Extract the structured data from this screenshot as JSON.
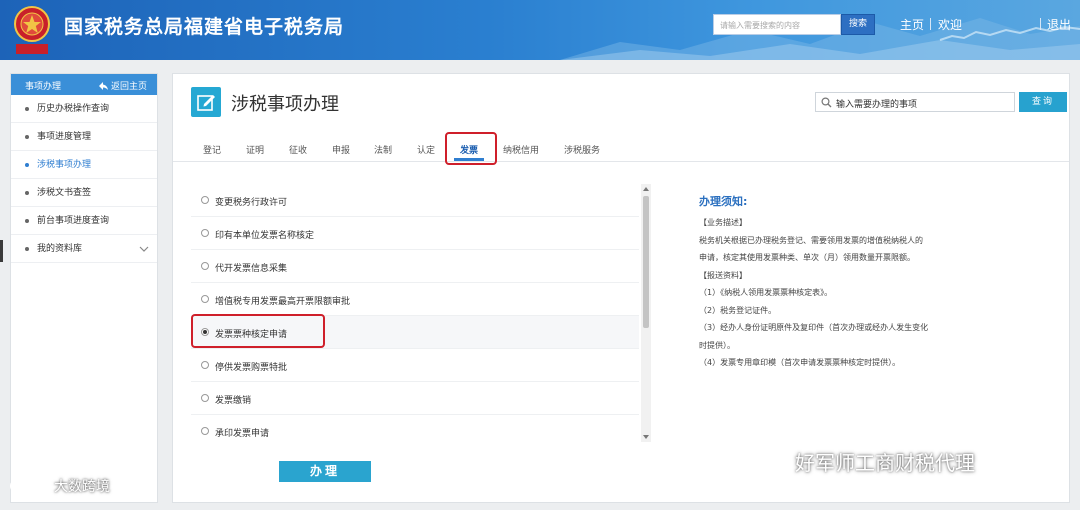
{
  "header": {
    "site_title": "国家税务总局福建省电子税务局",
    "emblem_text": "中国税务",
    "search_placeholder": "请输入需要搜索的内容",
    "search_button": "搜索",
    "home_link": "主页",
    "welcome_text": "欢迎",
    "logout_link": "退出",
    "colors": {
      "bar_start": "#1d63b8",
      "bar_end": "#5aa7e0"
    }
  },
  "sidebar": {
    "title": "事项办理",
    "back_label": "返回主页",
    "items": [
      {
        "label": "历史办税操作查询",
        "active": false
      },
      {
        "label": "事项进度管理",
        "active": false
      },
      {
        "label": "涉税事项办理",
        "active": true
      },
      {
        "label": "涉税文书查签",
        "active": false
      },
      {
        "label": "前台事项进度查询",
        "active": false
      },
      {
        "label": "我的资料库",
        "active": false,
        "expandable": true
      }
    ]
  },
  "main": {
    "page_title": "涉税事项办理",
    "search_placeholder": "输入需要办理的事项",
    "search_button": "查询",
    "tabs": [
      {
        "label": "登记"
      },
      {
        "label": "证明"
      },
      {
        "label": "征收"
      },
      {
        "label": "申报"
      },
      {
        "label": "法制"
      },
      {
        "label": "认定"
      },
      {
        "label": "发票",
        "active": true
      },
      {
        "label": "纳税信用"
      },
      {
        "label": "涉税服务"
      }
    ],
    "items": [
      {
        "label": "变更税务行政许可",
        "checked": false
      },
      {
        "label": "印有本单位发票名称核定",
        "checked": false
      },
      {
        "label": "代开发票信息采集",
        "checked": false
      },
      {
        "label": "增值税专用发票最高开票限额审批",
        "checked": false
      },
      {
        "label": "发票票种核定申请",
        "checked": true
      },
      {
        "label": "停供发票购票特批",
        "checked": false
      },
      {
        "label": "发票缴销",
        "checked": false
      },
      {
        "label": "承印发票申请",
        "checked": false
      }
    ],
    "action_button": "办理",
    "notice": {
      "title": "办理须知:",
      "lines": [
        "【业务描述】",
        "税务机关根据已办理税务登记、需要领用发票的增值税纳税人的",
        "申请，核定其使用发票种类、单次（月）领用数量开票限额。",
        "【报送资料】",
        "（1）《纳税人领用发票票种核定表》。",
        "（2）税务登记证件。",
        "（3）经办人身份证明原件及复印件（首次办理或经办人发生变化",
        "时提供）。",
        "（4）发票专用章印模（首次申请发票票种核定时提供）。"
      ]
    },
    "colors": {
      "accent": "#27a2cf",
      "highlight": "#cf1f2a",
      "link": "#2f7ed0"
    }
  },
  "watermarks": {
    "right": "好军师工商财税代理",
    "left": "大数跨境"
  }
}
